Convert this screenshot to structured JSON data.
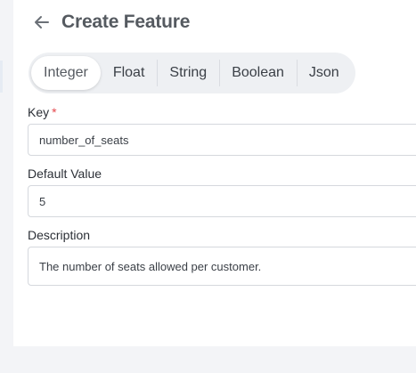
{
  "header": {
    "back_icon": "arrow-left-icon",
    "title": "Create Feature"
  },
  "tabs": [
    {
      "label": "Integer",
      "active": true
    },
    {
      "label": "Float",
      "active": false
    },
    {
      "label": "String",
      "active": false
    },
    {
      "label": "Boolean",
      "active": false
    },
    {
      "label": "Json",
      "active": false
    }
  ],
  "form": {
    "key": {
      "label": "Key",
      "required_marker": "*",
      "value": "number_of_seats"
    },
    "default_value": {
      "label": "Default Value",
      "value": "5"
    },
    "description": {
      "label": "Description",
      "value": "The number of seats allowed per customer."
    }
  },
  "colors": {
    "required": "#e5484d",
    "title": "#555a60",
    "tab_bar": "#eef0f3"
  }
}
